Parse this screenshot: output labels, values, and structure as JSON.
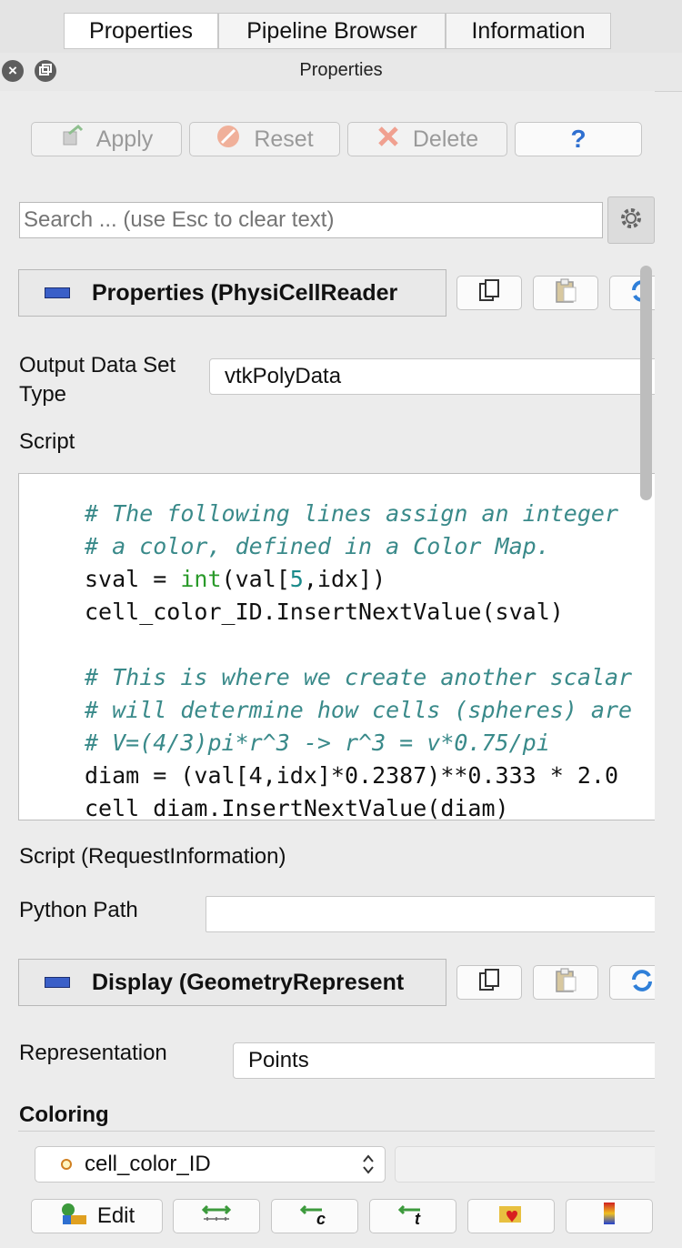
{
  "tabs": [
    {
      "label": "Properties",
      "active": true
    },
    {
      "label": "Pipeline Browser",
      "active": false
    },
    {
      "label": "Information",
      "active": false
    }
  ],
  "window": {
    "title": "Properties"
  },
  "actions": {
    "apply": "Apply",
    "reset": "Reset",
    "delete": "Delete",
    "help": "?"
  },
  "search": {
    "placeholder": "Search ... (use Esc to clear text)",
    "value": ""
  },
  "properties_section": {
    "title": "Properties (PhysiCellReader"
  },
  "output_type": {
    "label": "Output Data Set Type",
    "value": "vtkPolyData"
  },
  "script": {
    "label": "Script",
    "lines": [
      "",
      "# The following lines assign an integer",
      "# a color, defined in a Color Map.",
      "sval = int(val[5,idx])",
      "cell_color_ID.InsertNextValue(sval)",
      "",
      "# This is where we create another scalar",
      "# will determine how cells (spheres) are",
      "# V=(4/3)pi*r^3 -> r^3 = v*0.75/pi",
      "diam = (val[4,idx]*0.2387)**0.333 * 2.0",
      "cell_diam.InsertNextValue(diam)"
    ]
  },
  "script_request_info": {
    "label": "Script (RequestInformation)"
  },
  "python_path": {
    "label": "Python Path",
    "value": ""
  },
  "display_section": {
    "title": "Display (GeometryRepresent"
  },
  "representation": {
    "label": "Representation",
    "value": "Points"
  },
  "coloring": {
    "label": "Coloring",
    "array": "cell_color_ID",
    "edit": "Edit"
  },
  "colors": {
    "accent": "#3a5fc8",
    "comment": "#3a8a8a",
    "builtin": "#2a9a2a"
  }
}
